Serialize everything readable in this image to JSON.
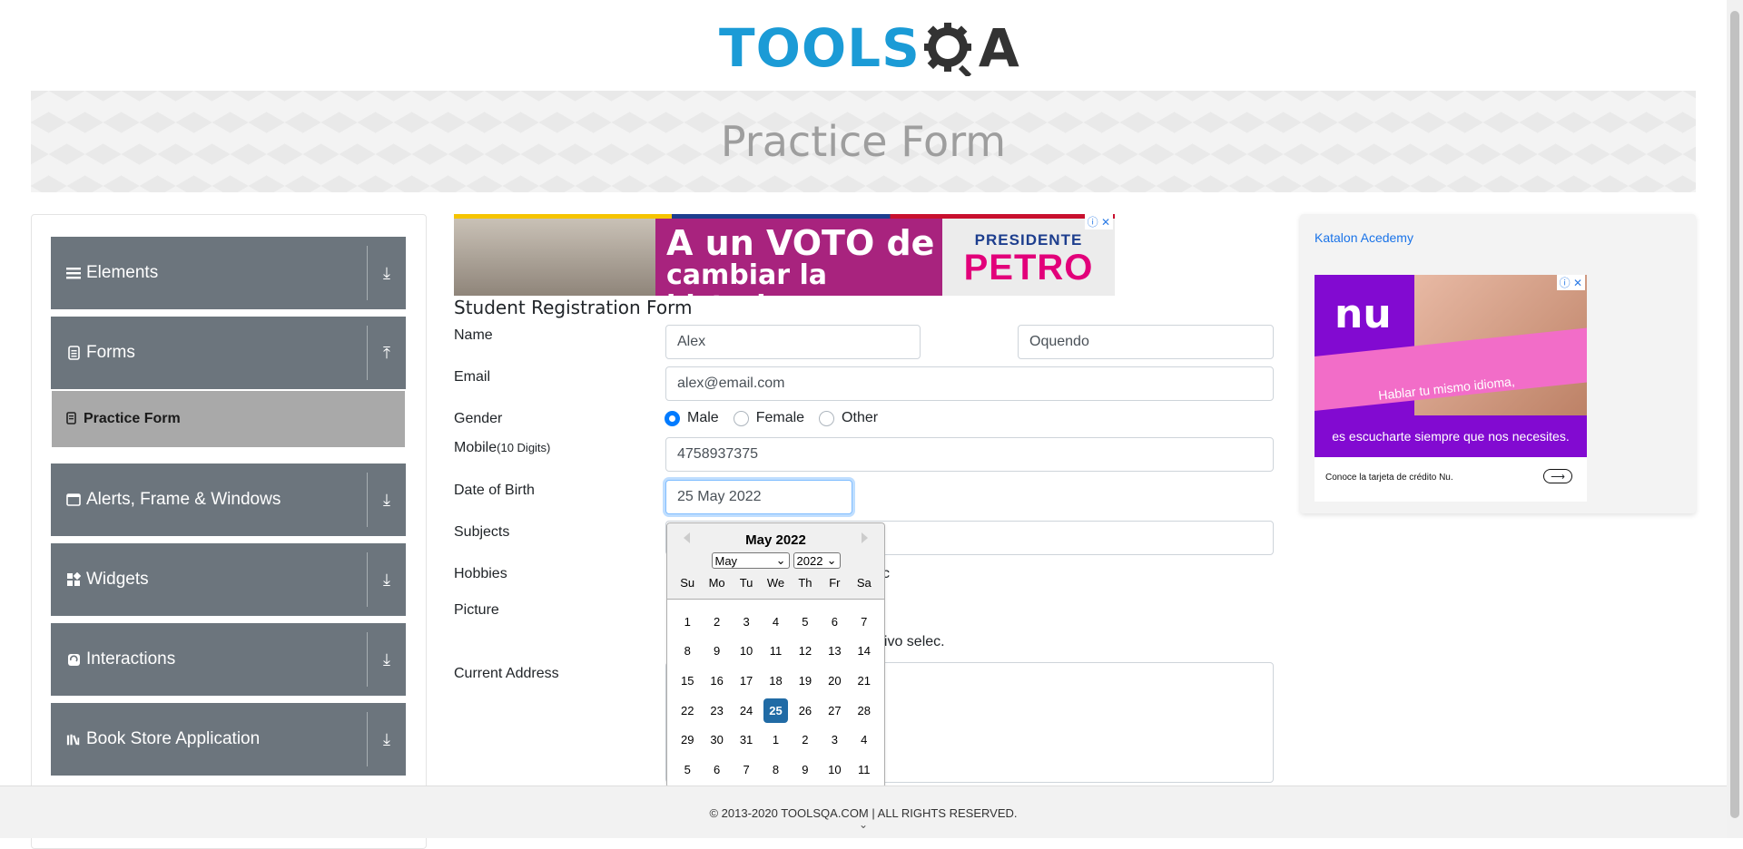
{
  "logo": {
    "part1": "TOOLS",
    "part2": "A"
  },
  "banner": {
    "title": "Practice Form"
  },
  "sidebar": {
    "groups": [
      {
        "label": "Elements",
        "icon": "menu-lines-icon",
        "arrow": "⤓"
      },
      {
        "label": "Forms",
        "icon": "document-icon",
        "arrow": "⤒"
      },
      {
        "label": "Alerts, Frame & Windows",
        "icon": "window-icon",
        "arrow": "⤓"
      },
      {
        "label": "Widgets",
        "icon": "widgets-icon",
        "arrow": "⤓"
      },
      {
        "label": "Interactions",
        "icon": "interactions-icon",
        "arrow": "⤓"
      },
      {
        "label": "Book Store Application",
        "icon": "books-icon",
        "arrow": "⤓"
      }
    ],
    "active_item": "Practice Form"
  },
  "ad_top": {
    "line1": "A un VOTO de",
    "line2": "cambiar la historia",
    "pres1": "PRESIDENTE",
    "pres2": "PETRO"
  },
  "form": {
    "title": "Student Registration Form",
    "labels": {
      "name": "Name",
      "email": "Email",
      "gender": "Gender",
      "mobile": "Mobile",
      "mobile_hint": "(10 Digits)",
      "dob": "Date of Birth",
      "subjects": "Subjects",
      "hobbies": "Hobbies",
      "picture": "Picture",
      "address": "Current Address"
    },
    "first_name": "Alex",
    "last_name": "Oquendo",
    "email": "alex@email.com",
    "gender_options": [
      "Male",
      "Female",
      "Other"
    ],
    "gender_selected": "Male",
    "mobile": "4758937375",
    "dob": "25 May 2022",
    "hobbies_partial": "c",
    "file_partial": "hivo selec."
  },
  "datepicker": {
    "title": "May 2022",
    "month_select": "May",
    "year_select": "2022",
    "weekdays": [
      "Su",
      "Mo",
      "Tu",
      "We",
      "Th",
      "Fr",
      "Sa"
    ],
    "days": [
      "1",
      "2",
      "3",
      "4",
      "5",
      "6",
      "7",
      "8",
      "9",
      "10",
      "11",
      "12",
      "13",
      "14",
      "15",
      "16",
      "17",
      "18",
      "19",
      "20",
      "21",
      "22",
      "23",
      "24",
      "25",
      "26",
      "27",
      "28",
      "29",
      "30",
      "31",
      "1",
      "2",
      "3",
      "4",
      "5",
      "6",
      "7",
      "8",
      "9",
      "10",
      "11"
    ],
    "selected_day": "25"
  },
  "ad_right": {
    "alt_text": "Katalon Acedemy",
    "nu_logo": "nu",
    "nu_pink": "Hablar tu mismo idioma,",
    "nu_purple": "es escucharte siempre que nos necesites.",
    "nu_foot": "Conoce la tarjeta de crédito Nu."
  },
  "footer": {
    "copyright": "© 2013-2020 TOOLSQA.COM | ALL RIGHTS RESERVED."
  },
  "colors": {
    "brand_blue": "#1b9bd6",
    "sidebar_gray": "#6c757d",
    "active_gray": "#a9a9a9",
    "selected_day": "#216ba5"
  }
}
